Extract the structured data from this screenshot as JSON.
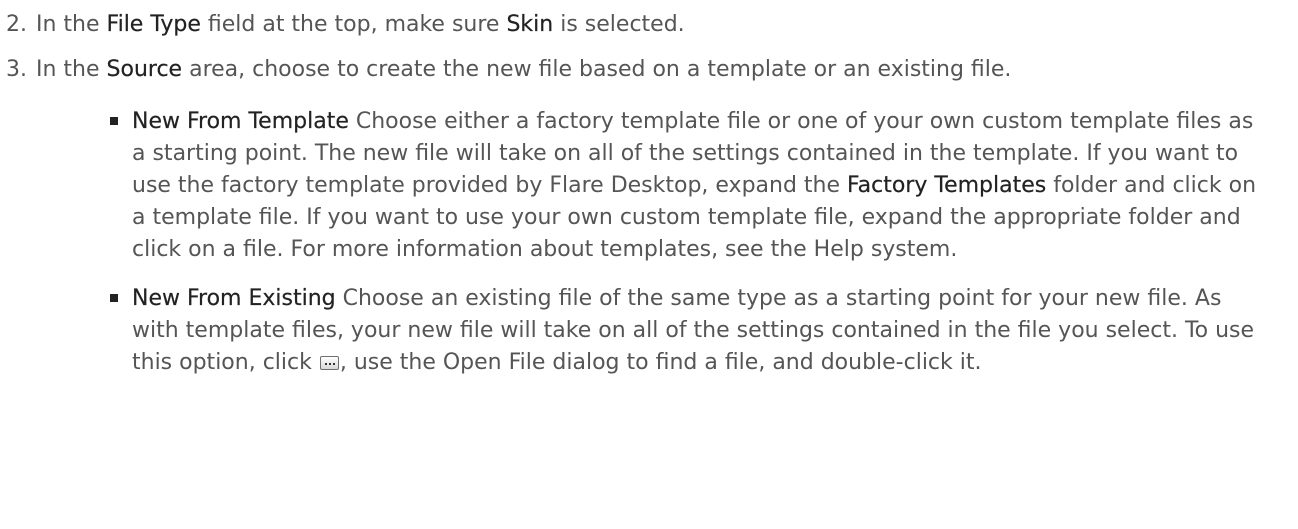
{
  "steps": [
    {
      "number": "2.",
      "parts": [
        "In the ",
        "File Type",
        " field at the top, make sure ",
        "Skin",
        " is selected."
      ]
    },
    {
      "number": "3.",
      "parts": [
        "In the ",
        "Source",
        " area, choose to create the new file based on a template or an existing file."
      ]
    }
  ],
  "bullets": [
    {
      "term": "New From Template",
      "parts": [
        " Choose either a factory template file or one of your own custom template files as a starting point. The new file will take on all of the settings contained in the template. If you want to use the factory template provided by Flare Desktop, expand the ",
        "Factory Templates",
        " folder and click on a template file. If you want to use your own custom template file, expand the appropriate folder and click on a file. For more information about templates, see the Help system."
      ]
    },
    {
      "term": "New From Existing",
      "parts": [
        " Choose an existing file of the same type as a starting point for your new file. As with template files, your new file will take on all of the settings contained in the file you select. To use this option, click ",
        ", use the Open File dialog to find a file, and double-click it."
      ]
    }
  ],
  "icons": {
    "browse": "browse-ellipsis-button-icon"
  }
}
